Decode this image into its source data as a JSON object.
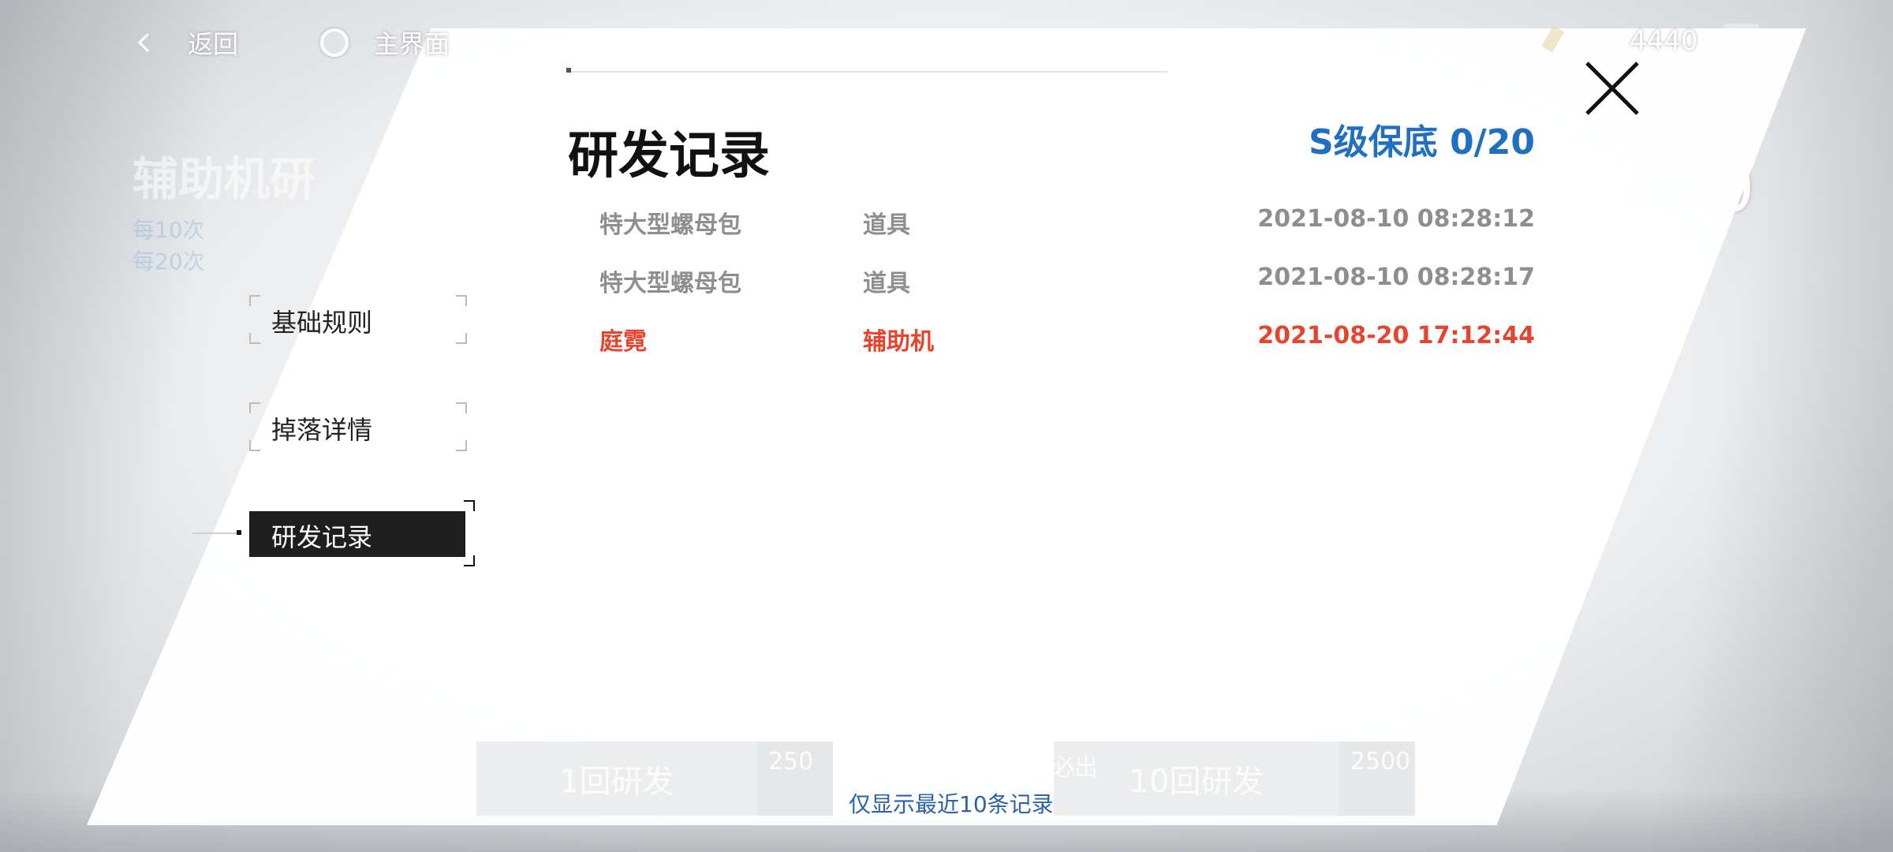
{
  "topbar": {
    "back_label": "返回",
    "home_label": "主界面",
    "currency_value": "4440",
    "add_label": "+"
  },
  "background": {
    "title": "辅助机研",
    "sub_line1": "每10次",
    "sub_line2": "每20次",
    "right_count": "0",
    "pull1_label": "1回研发",
    "pull1_cost": "250",
    "must_label": "必出",
    "pull10_label": "10回研发",
    "pull10_cost": "2500"
  },
  "modal": {
    "title": "研发记录",
    "pity_label": "S级保底 0/20",
    "footer_note": "仅显示最近10条记录"
  },
  "nav": {
    "items": [
      {
        "label": "基础规则",
        "active": false
      },
      {
        "label": "掉落详情",
        "active": false
      },
      {
        "label": "研发记录",
        "active": true
      }
    ]
  },
  "records": [
    {
      "name": "特大型螺母包",
      "type": "道具",
      "time": "2021-08-10 08:28:12",
      "highlight": false
    },
    {
      "name": "特大型螺母包",
      "type": "道具",
      "time": "2021-08-10 08:28:17",
      "highlight": false
    },
    {
      "name": "庭霓",
      "type": "辅助机",
      "time": "2021-08-20 17:12:44",
      "highlight": true
    }
  ],
  "colors": {
    "accent_blue": "#1f6fc2",
    "highlight_red": "#e8442d",
    "normal_gray": "#8e8e8e",
    "active_nav_bg": "#1e1e1e"
  }
}
